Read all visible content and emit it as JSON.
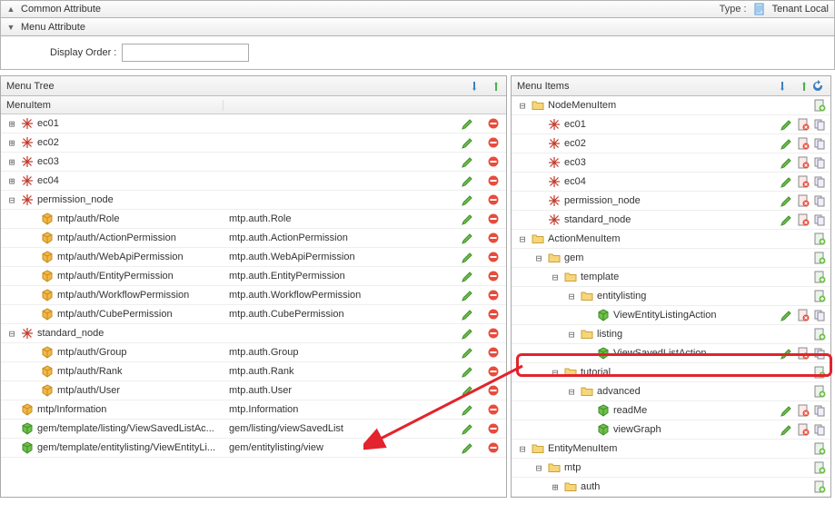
{
  "headers": {
    "common_attribute": "Common Attribute",
    "type_label": "Type :",
    "type_value": "Tenant Local",
    "menu_attribute": "Menu Attribute",
    "display_order": "Display Order :"
  },
  "panels": {
    "menu_tree": "Menu Tree",
    "menu_items": "Menu Items",
    "col_menuitem": "MenuItem"
  },
  "left_rows": [
    {
      "ind": 0,
      "exp": "+",
      "icon": "snowflake",
      "text": "ec01",
      "c2": "",
      "edit": true,
      "del": true
    },
    {
      "ind": 0,
      "exp": "+",
      "icon": "snowflake",
      "text": "ec02",
      "c2": "",
      "edit": true,
      "del": true
    },
    {
      "ind": 0,
      "exp": "+",
      "icon": "snowflake",
      "text": "ec03",
      "c2": "",
      "edit": true,
      "del": true
    },
    {
      "ind": 0,
      "exp": "+",
      "icon": "snowflake",
      "text": "ec04",
      "c2": "",
      "edit": true,
      "del": true
    },
    {
      "ind": 0,
      "exp": "-",
      "icon": "snowflake",
      "text": "permission_node",
      "c2": "",
      "edit": true,
      "del": true
    },
    {
      "ind": 1,
      "exp": "",
      "icon": "cube-y",
      "text": "mtp/auth/Role",
      "c2": "mtp.auth.Role",
      "edit": true,
      "del": true
    },
    {
      "ind": 1,
      "exp": "",
      "icon": "cube-y",
      "text": "mtp/auth/ActionPermission",
      "c2": "mtp.auth.ActionPermission",
      "edit": true,
      "del": true
    },
    {
      "ind": 1,
      "exp": "",
      "icon": "cube-y",
      "text": "mtp/auth/WebApiPermission",
      "c2": "mtp.auth.WebApiPermission",
      "edit": true,
      "del": true
    },
    {
      "ind": 1,
      "exp": "",
      "icon": "cube-y",
      "text": "mtp/auth/EntityPermission",
      "c2": "mtp.auth.EntityPermission",
      "edit": true,
      "del": true
    },
    {
      "ind": 1,
      "exp": "",
      "icon": "cube-y",
      "text": "mtp/auth/WorkflowPermission",
      "c2": "mtp.auth.WorkflowPermission",
      "edit": true,
      "del": true
    },
    {
      "ind": 1,
      "exp": "",
      "icon": "cube-y",
      "text": "mtp/auth/CubePermission",
      "c2": "mtp.auth.CubePermission",
      "edit": true,
      "del": true
    },
    {
      "ind": 0,
      "exp": "-",
      "icon": "snowflake",
      "text": "standard_node",
      "c2": "",
      "edit": true,
      "del": true
    },
    {
      "ind": 1,
      "exp": "",
      "icon": "cube-y",
      "text": "mtp/auth/Group",
      "c2": "mtp.auth.Group",
      "edit": true,
      "del": true
    },
    {
      "ind": 1,
      "exp": "",
      "icon": "cube-y",
      "text": "mtp/auth/Rank",
      "c2": "mtp.auth.Rank",
      "edit": true,
      "del": true
    },
    {
      "ind": 1,
      "exp": "",
      "icon": "cube-y",
      "text": "mtp/auth/User",
      "c2": "mtp.auth.User",
      "edit": true,
      "del": true
    },
    {
      "ind": 0,
      "exp": "",
      "icon": "cube-y",
      "text": "mtp/Information",
      "c2": "mtp.Information",
      "edit": true,
      "del": true
    },
    {
      "ind": 0,
      "exp": "",
      "icon": "cube-g",
      "text": "gem/template/listing/ViewSavedListAc...",
      "c2": "gem/listing/viewSavedList",
      "edit": true,
      "del": true
    },
    {
      "ind": 0,
      "exp": "",
      "icon": "cube-g",
      "text": "gem/template/entitylisting/ViewEntityLi...",
      "c2": "gem/entitylisting/view",
      "edit": true,
      "del": true
    }
  ],
  "right_rows": [
    {
      "ind": 0,
      "exp": "-",
      "icon": "folder",
      "text": "NodeMenuItem",
      "actions": [
        "add"
      ],
      "sel": false
    },
    {
      "ind": 1,
      "exp": "",
      "icon": "snowflake",
      "text": "ec01",
      "actions": [
        "edit",
        "delx",
        "copy"
      ],
      "sel": false
    },
    {
      "ind": 1,
      "exp": "",
      "icon": "snowflake",
      "text": "ec02",
      "actions": [
        "edit",
        "delx",
        "copy"
      ],
      "sel": false
    },
    {
      "ind": 1,
      "exp": "",
      "icon": "snowflake",
      "text": "ec03",
      "actions": [
        "edit",
        "delx",
        "copy"
      ],
      "sel": false
    },
    {
      "ind": 1,
      "exp": "",
      "icon": "snowflake",
      "text": "ec04",
      "actions": [
        "edit",
        "delx",
        "copy"
      ],
      "sel": false
    },
    {
      "ind": 1,
      "exp": "",
      "icon": "snowflake",
      "text": "permission_node",
      "actions": [
        "edit",
        "delx",
        "copy"
      ],
      "sel": false
    },
    {
      "ind": 1,
      "exp": "",
      "icon": "snowflake",
      "text": "standard_node",
      "actions": [
        "edit",
        "delx",
        "copy"
      ],
      "sel": false
    },
    {
      "ind": 0,
      "exp": "-",
      "icon": "folder",
      "text": "ActionMenuItem",
      "actions": [
        "add"
      ],
      "sel": false
    },
    {
      "ind": 1,
      "exp": "-",
      "icon": "folder",
      "text": "gem",
      "actions": [
        "add"
      ],
      "sel": false
    },
    {
      "ind": 2,
      "exp": "-",
      "icon": "folder",
      "text": "template",
      "actions": [
        "add"
      ],
      "sel": false
    },
    {
      "ind": 3,
      "exp": "-",
      "icon": "folder",
      "text": "entitylisting",
      "actions": [
        "add"
      ],
      "sel": false
    },
    {
      "ind": 4,
      "exp": "",
      "icon": "cube-g",
      "text": "ViewEntityListingAction",
      "actions": [
        "edit",
        "delx",
        "copy"
      ],
      "sel": false
    },
    {
      "ind": 3,
      "exp": "-",
      "icon": "folder",
      "text": "listing",
      "actions": [
        "add"
      ],
      "sel": false
    },
    {
      "ind": 4,
      "exp": "",
      "icon": "cube-g",
      "text": "ViewSavedListAction",
      "actions": [
        "edit",
        "delx",
        "copy"
      ],
      "sel": true
    },
    {
      "ind": 2,
      "exp": "-",
      "icon": "folder",
      "text": "tutorial",
      "actions": [
        "add"
      ],
      "sel": false
    },
    {
      "ind": 3,
      "exp": "-",
      "icon": "folder",
      "text": "advanced",
      "actions": [
        "add"
      ],
      "sel": false
    },
    {
      "ind": 4,
      "exp": "",
      "icon": "cube-g",
      "text": "readMe",
      "actions": [
        "edit",
        "delx",
        "copy"
      ],
      "sel": false
    },
    {
      "ind": 4,
      "exp": "",
      "icon": "cube-g",
      "text": "viewGraph",
      "actions": [
        "edit",
        "delx",
        "copy"
      ],
      "sel": false
    },
    {
      "ind": 0,
      "exp": "-",
      "icon": "folder",
      "text": "EntityMenuItem",
      "actions": [
        "add"
      ],
      "sel": false
    },
    {
      "ind": 1,
      "exp": "-",
      "icon": "folder",
      "text": "mtp",
      "actions": [
        "add"
      ],
      "sel": false
    },
    {
      "ind": 2,
      "exp": "+",
      "icon": "folder",
      "text": "auth",
      "actions": [
        "add"
      ],
      "sel": false
    }
  ]
}
